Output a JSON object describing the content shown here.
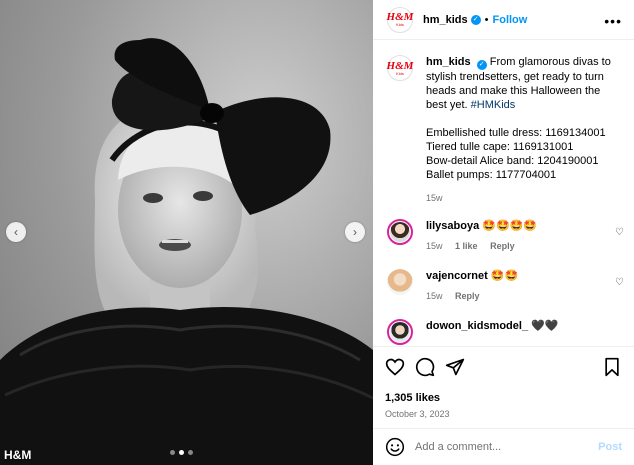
{
  "photo": {
    "watermark": "H&M",
    "prev_arrow": "‹",
    "next_arrow": "›",
    "dot_count": 3,
    "active_dot": 1
  },
  "header": {
    "username": "hm_kids",
    "verified_glyph": "✓",
    "separator": "•",
    "follow_label": "Follow",
    "more_glyph": "•••",
    "avatar_logo": "H&M",
    "avatar_sub": "Kids"
  },
  "caption": {
    "username": "hm_kids",
    "text": "From glamorous divas to stylish trendsetters, get ready to turn heads and make this Halloween the best yet.",
    "hashtag": "#HMKids",
    "lines": [
      "Embellished tulle dress: 1169134001",
      "Tiered tulle cape: 1169131001",
      "Bow-detail Alice band: 1204190001",
      "Ballet pumps: 1177704001"
    ],
    "time": "15w"
  },
  "comments": [
    {
      "username": "lilysaboya",
      "text": "🤩🤩🤩🤩",
      "time": "15w",
      "likes": "1 like",
      "reply": "Reply"
    },
    {
      "username": "vajencornet",
      "text": "🤩🤩",
      "time": "15w",
      "likes": "",
      "reply": "Reply"
    },
    {
      "username": "dowon_kidsmodel_",
      "text": "🖤🖤",
      "time": "",
      "likes": "",
      "reply": ""
    }
  ],
  "actions": {
    "likes": "1,305 likes",
    "date": "October 3, 2023"
  },
  "add_comment": {
    "placeholder": "Add a comment...",
    "post_label": "Post"
  },
  "colors": {
    "accent": "#0095f6",
    "brand": "#e50010",
    "muted": "#737373"
  }
}
